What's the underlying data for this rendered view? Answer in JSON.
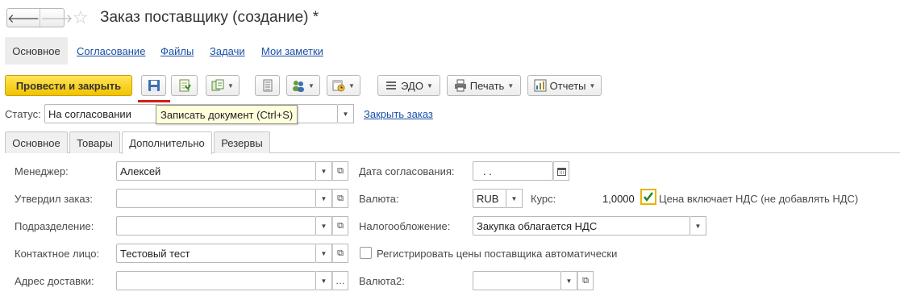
{
  "window": {
    "title": "Заказ поставщику (создание) *"
  },
  "nav": {
    "back": "🡐",
    "forward": "🡒"
  },
  "top_tabs": [
    "Основное",
    "Согласование",
    "Файлы",
    "Задачи",
    "Мои заметки"
  ],
  "toolbar": {
    "post_and_close": "Провести и закрыть",
    "edo": "ЭДО",
    "print": "Печать",
    "reports": "Отчеты",
    "tooltip": "Записать документ (Ctrl+S)"
  },
  "status": {
    "label": "Статус:",
    "value": "На согласовании",
    "close_order": "Закрыть заказ"
  },
  "form_tabs": [
    "Основное",
    "Товары",
    "Дополнительно",
    "Резервы"
  ],
  "fields": {
    "manager": {
      "label": "Менеджер:",
      "value": "Алексей"
    },
    "approved_by": {
      "label": "Утвердил заказ:",
      "value": ""
    },
    "department": {
      "label": "Подразделение:",
      "value": ""
    },
    "contact": {
      "label": "Контактное лицо:",
      "value": "Тестовый тест"
    },
    "delivery_address": {
      "label": "Адрес доставки:",
      "value": ""
    },
    "approval_date": {
      "label": "Дата согласования:",
      "value": ". ."
    },
    "currency": {
      "label": "Валюта:",
      "value": "RUB"
    },
    "rate": {
      "label": "Курс:",
      "value": "1,0000"
    },
    "vat_included": {
      "label": "Цена включает НДС (не добавлять НДС)",
      "checked": true
    },
    "taxation": {
      "label": "Налогообложение:",
      "value": "Закупка облагается НДС"
    },
    "register_prices": {
      "label": "Регистрировать цены поставщика автоматически",
      "checked": false
    },
    "currency2": {
      "label": "Валюта2:",
      "value": ""
    }
  },
  "colors": {
    "accent": "#f2c300",
    "link": "#1a50a8",
    "red_underline": "#d21c1c",
    "tooltip_bg": "#ffffdc"
  }
}
